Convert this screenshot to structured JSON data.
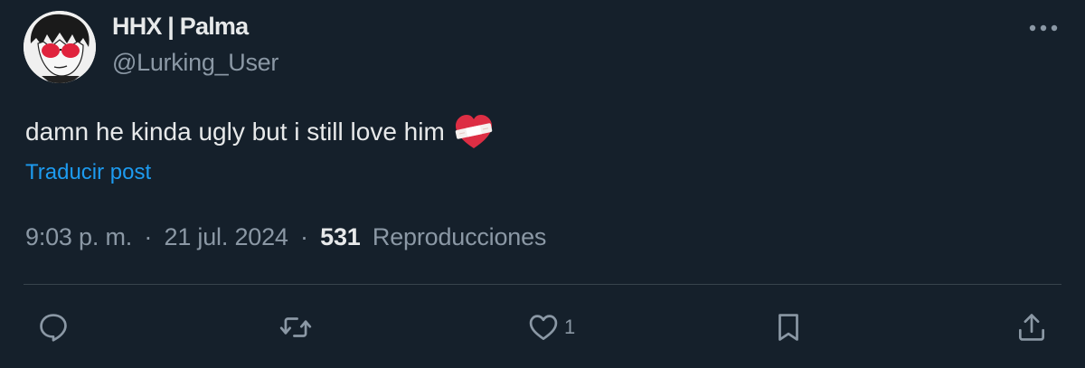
{
  "user": {
    "display_name": "HHX | Palma",
    "handle": "@Lurking_User"
  },
  "post": {
    "text": "damn he kinda ugly but i still love him",
    "emoji": "heart-with-bandage",
    "translate_label": "Traducir post"
  },
  "meta": {
    "time": "9:03 p. m.",
    "separator": "·",
    "date": "21 jul. 2024",
    "views_count": "531",
    "views_label": "Reproducciones"
  },
  "actions": {
    "like_count": "1"
  },
  "colors": {
    "background": "#15202b",
    "primary_text": "#e7e9ea",
    "secondary_text": "#8b98a5",
    "link": "#1d9bf0",
    "divider": "#38444d"
  }
}
